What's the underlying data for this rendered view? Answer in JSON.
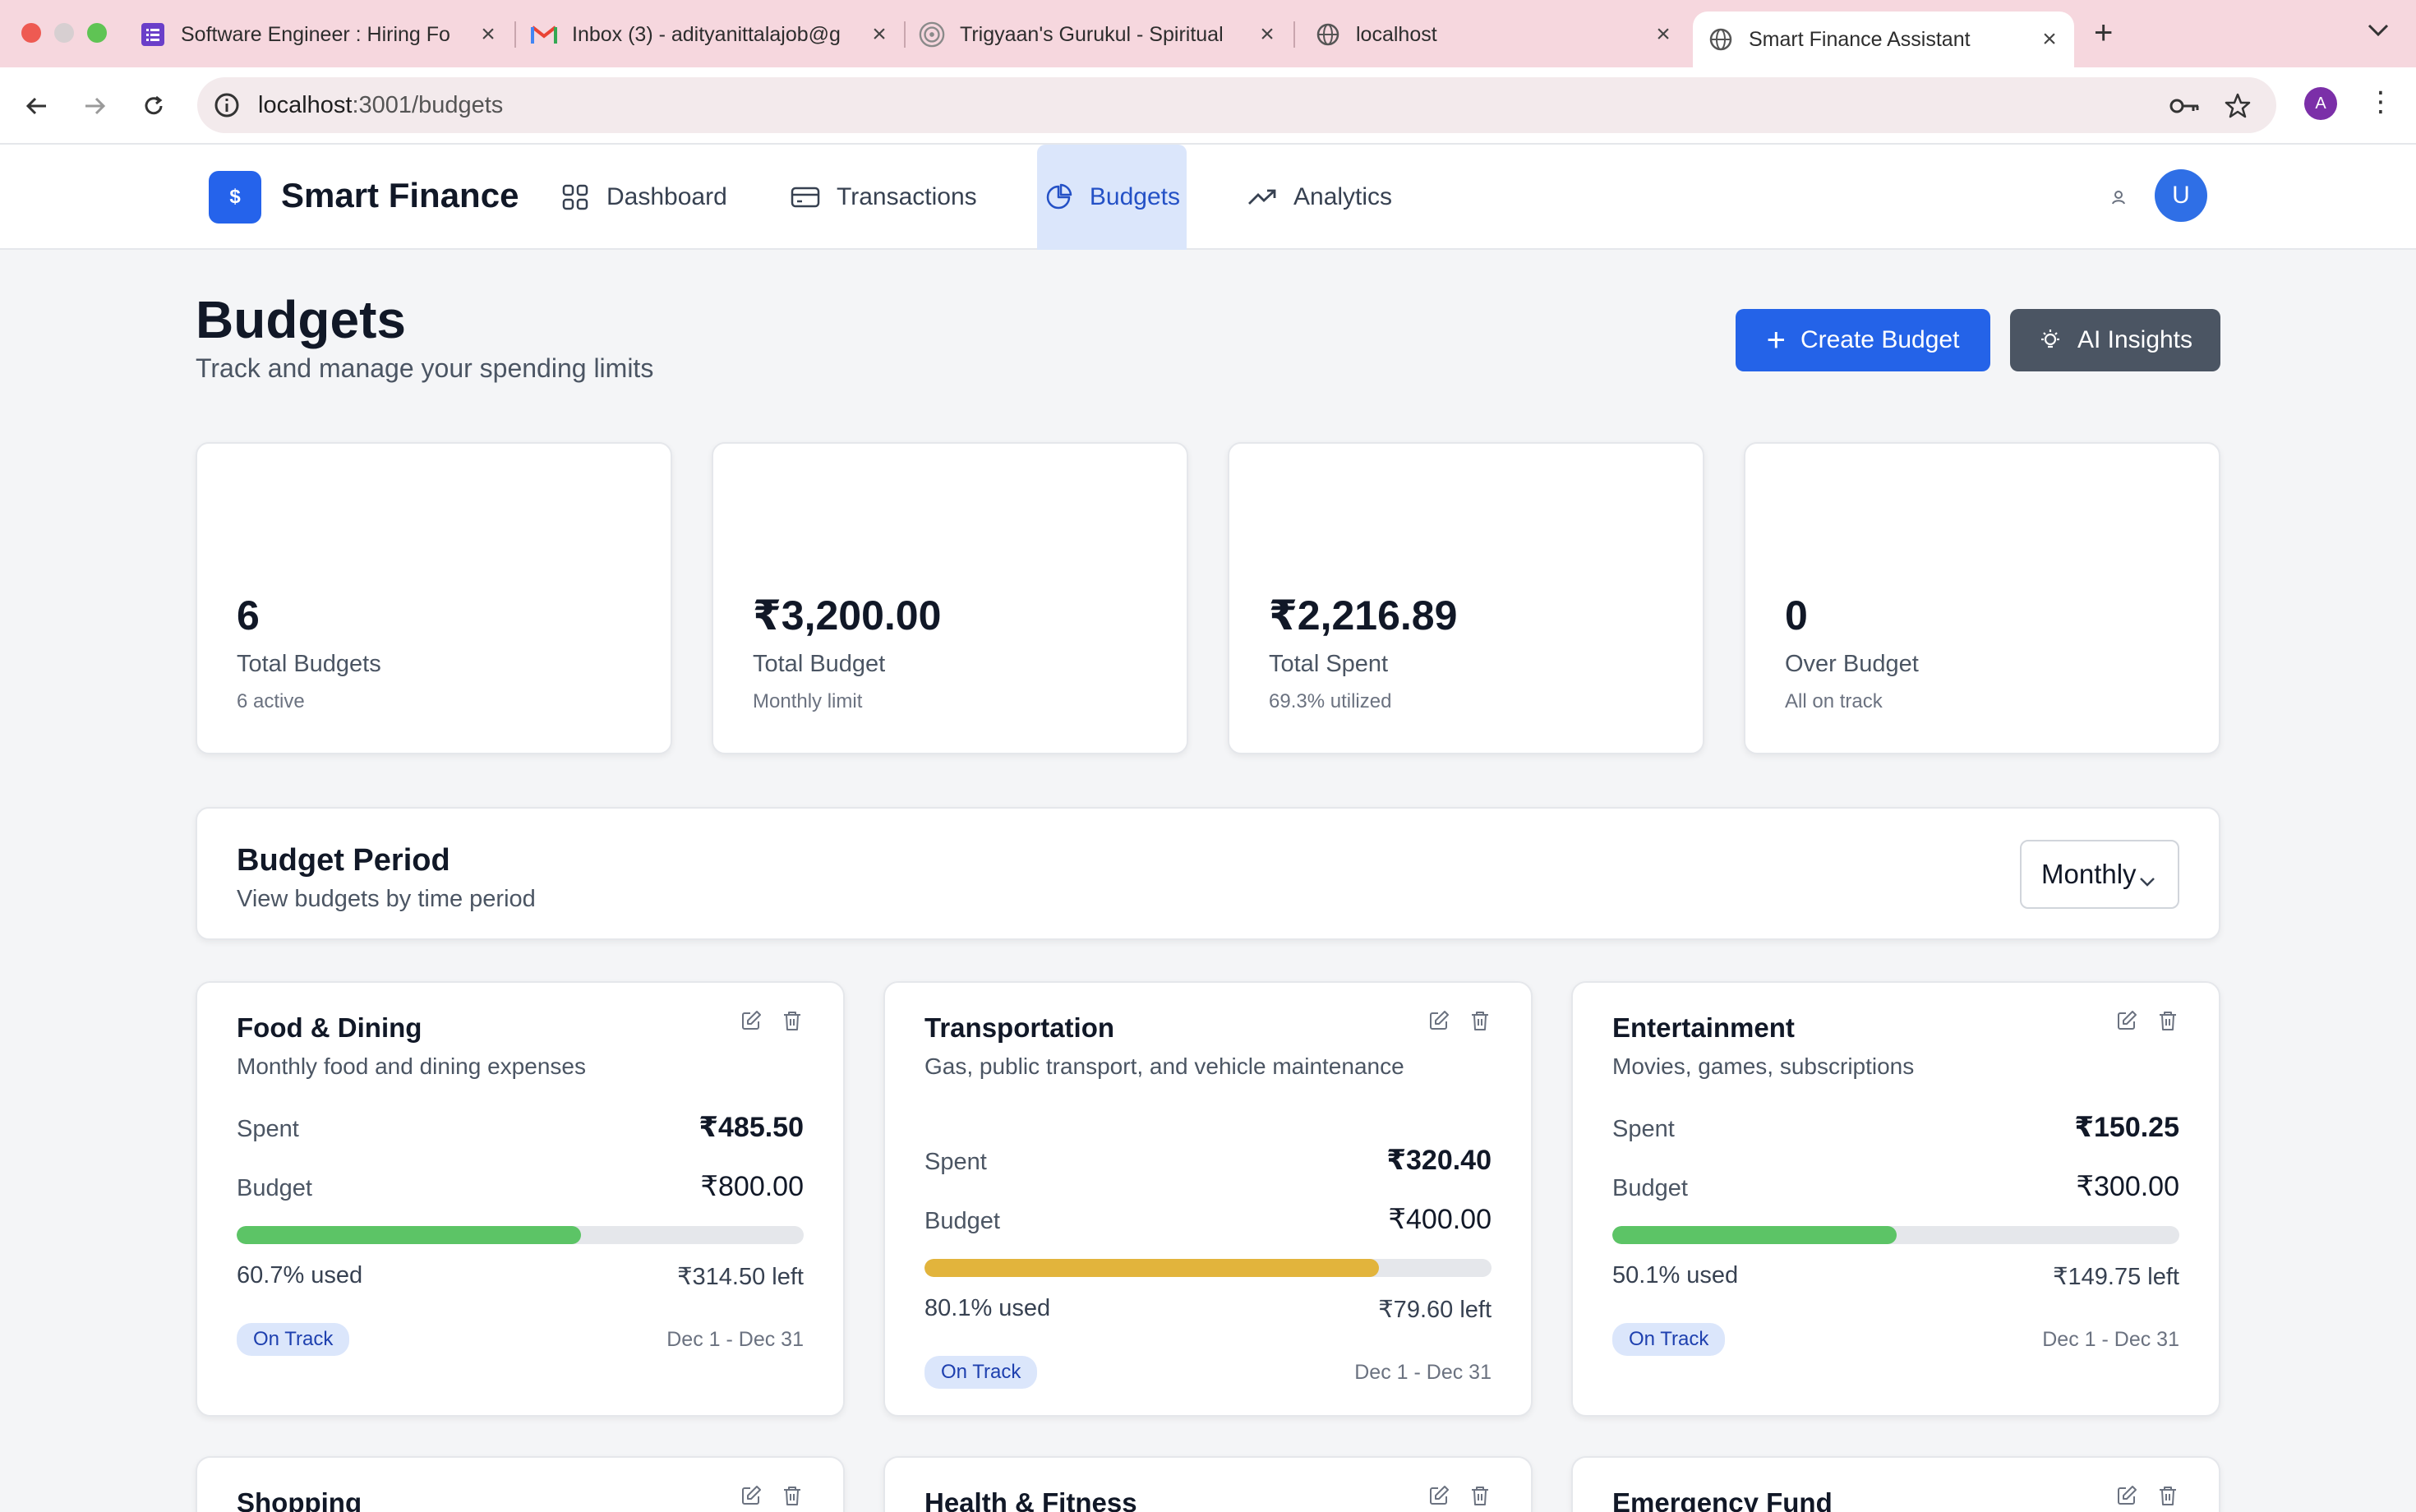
{
  "browser": {
    "tabs": [
      {
        "title": "Software Engineer : Hiring Fo",
        "icon": "forms-icon"
      },
      {
        "title": "Inbox (3) - adityanittalajob@g",
        "icon": "gmail-icon"
      },
      {
        "title": "Trigyaan's Gurukul - Spiritual",
        "icon": "spiral-icon"
      },
      {
        "title": "localhost",
        "icon": "globe-icon"
      },
      {
        "title": "Smart Finance Assistant",
        "icon": "globe-icon"
      }
    ],
    "url_host": "localhost",
    "url_path": ":3001/budgets",
    "profile_initial": "A"
  },
  "app": {
    "logo_glyph": "$",
    "name": "Smart Finance",
    "nav": [
      {
        "label": "Dashboard",
        "icon": "grid-icon"
      },
      {
        "label": "Transactions",
        "icon": "credit-card-icon"
      },
      {
        "label": "Budgets",
        "icon": "pie-chart-icon"
      },
      {
        "label": "Analytics",
        "icon": "trending-up-icon"
      }
    ],
    "active_nav": "Budgets",
    "user_initial": "U"
  },
  "page": {
    "title": "Budgets",
    "subtitle": "Track and manage your spending limits",
    "create_button": "Create Budget",
    "ai_button": "AI Insights"
  },
  "stats": [
    {
      "value": "6",
      "label": "Total Budgets",
      "sub": "6 active"
    },
    {
      "value": "₹3,200.00",
      "label": "Total Budget",
      "sub": "Monthly limit"
    },
    {
      "value": "₹2,216.89",
      "label": "Total Spent",
      "sub": "69.3% utilized"
    },
    {
      "value": "0",
      "label": "Over Budget",
      "sub": "All on track"
    }
  ],
  "period": {
    "title": "Budget Period",
    "subtitle": "View budgets by time period",
    "selected": "Monthly"
  },
  "labels": {
    "spent": "Spent",
    "budget": "Budget"
  },
  "budgets": [
    {
      "name": "Food & Dining",
      "desc": "Monthly food and dining expenses",
      "spent": "₹485.50",
      "budget": "₹800.00",
      "used": "60.7% used",
      "left": "₹314.50 left",
      "fraction": 0.607,
      "bar_color": "#5cc466",
      "status": "On Track",
      "dates": "Dec 1 - Dec 31"
    },
    {
      "name": "Transportation",
      "desc": "Gas, public transport, and vehicle maintenance",
      "spent": "₹320.40",
      "budget": "₹400.00",
      "used": "80.1% used",
      "left": "₹79.60 left",
      "fraction": 0.801,
      "bar_color": "#e2b43c",
      "status": "On Track",
      "dates": "Dec 1 - Dec 31"
    },
    {
      "name": "Entertainment",
      "desc": "Movies, games, subscriptions",
      "spent": "₹150.25",
      "budget": "₹300.00",
      "used": "50.1% used",
      "left": "₹149.75 left",
      "fraction": 0.501,
      "bar_color": "#5cc466",
      "status": "On Track",
      "dates": "Dec 1 - Dec 31"
    },
    {
      "name": "Shopping"
    },
    {
      "name": "Health & Fitness"
    },
    {
      "name": "Emergency Fund"
    }
  ]
}
